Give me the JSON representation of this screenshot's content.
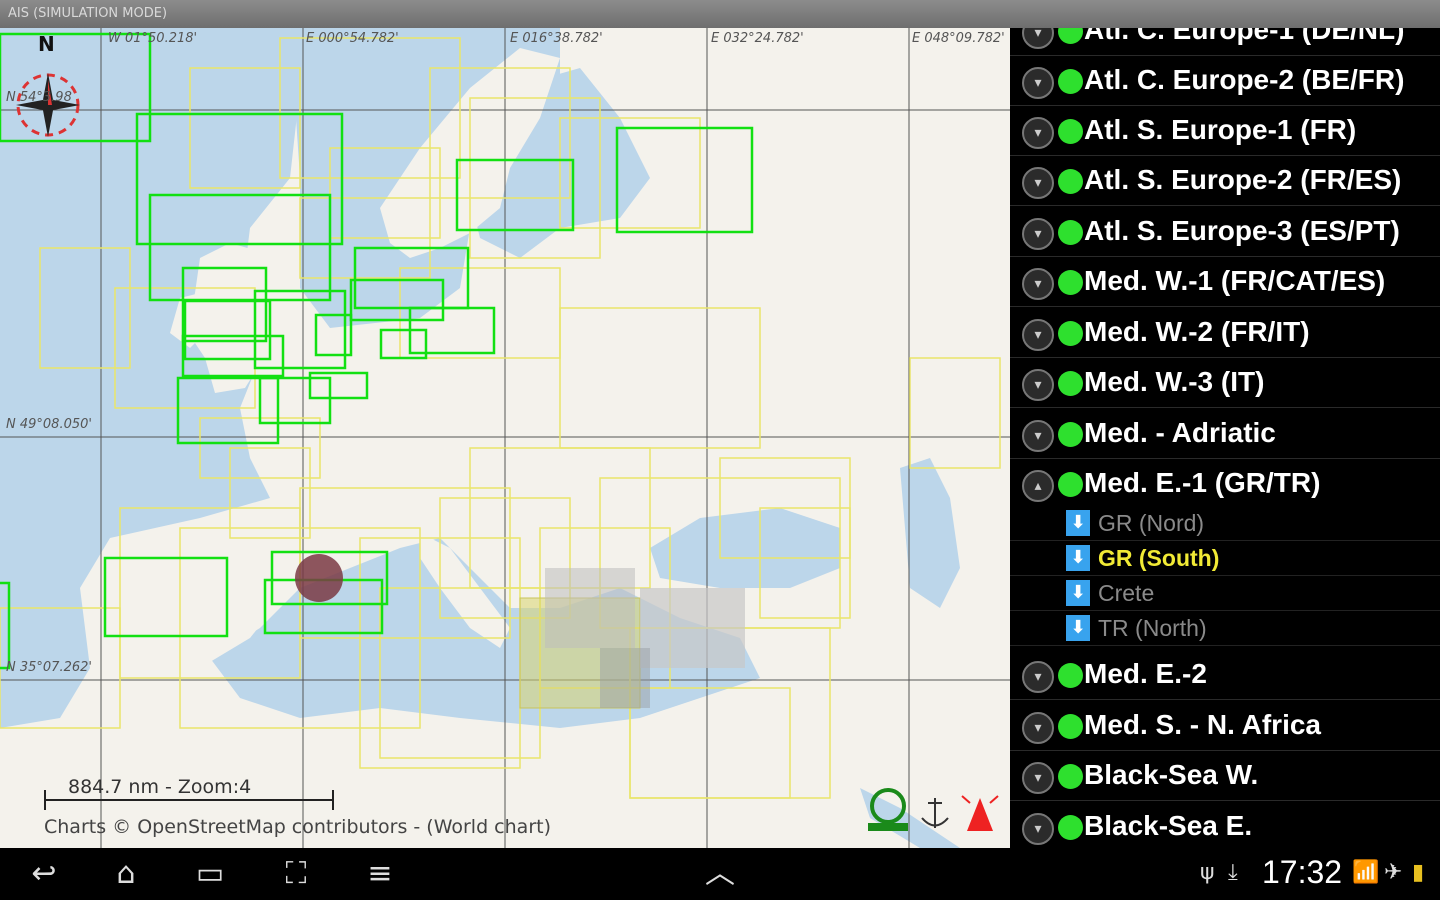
{
  "titlebar": {
    "title": "AIS (SIMULATION MODE)"
  },
  "map": {
    "coords_top": [
      "W 01°50.218'",
      "E 000°54.782'",
      "E 016°38.782'",
      "E 032°24.782'",
      "E 048°09.782'"
    ],
    "coords_left": [
      "N 54°3.98",
      "N 49°08.050'",
      "N 35°07.262'"
    ],
    "compass_north": "N",
    "scale": "884.7 nm - Zoom:4",
    "attribution": "Charts © OpenStreetMap contributors - (World chart)",
    "colors": {
      "water": "#bcd6ea",
      "land": "#f4f2ec",
      "chart_green": "#12e012",
      "chart_yellow": "#f2ef80"
    }
  },
  "panel": {
    "items": [
      {
        "label": "Atl. C. Europe-1 (DE/NL)",
        "state": "collapsed"
      },
      {
        "label": "Atl. C. Europe-2 (BE/FR)",
        "state": "collapsed"
      },
      {
        "label": "Atl. S. Europe-1 (FR)",
        "state": "collapsed"
      },
      {
        "label": "Atl. S. Europe-2 (FR/ES)",
        "state": "collapsed"
      },
      {
        "label": "Atl. S. Europe-3 (ES/PT)",
        "state": "collapsed"
      },
      {
        "label": "Med. W.-1 (FR/CAT/ES)",
        "state": "collapsed"
      },
      {
        "label": "Med. W.-2 (FR/IT)",
        "state": "collapsed"
      },
      {
        "label": "Med. W.-3 (IT)",
        "state": "collapsed"
      },
      {
        "label": "Med. - Adriatic",
        "state": "collapsed"
      },
      {
        "label": "Med. E.-1 (GR/TR)",
        "state": "expanded"
      }
    ],
    "subitems": [
      {
        "label": "GR (Nord)",
        "selected": false
      },
      {
        "label": "GR (South)",
        "selected": true
      },
      {
        "label": "Crete",
        "selected": false
      },
      {
        "label": "TR (North)",
        "selected": false
      }
    ],
    "items_after": [
      {
        "label": "Med. E.-2"
      },
      {
        "label": "Med. S. - N. Africa"
      },
      {
        "label": "Black-Sea W."
      },
      {
        "label": "Black-Sea E."
      }
    ]
  },
  "statusbar": {
    "time": "17:32"
  }
}
